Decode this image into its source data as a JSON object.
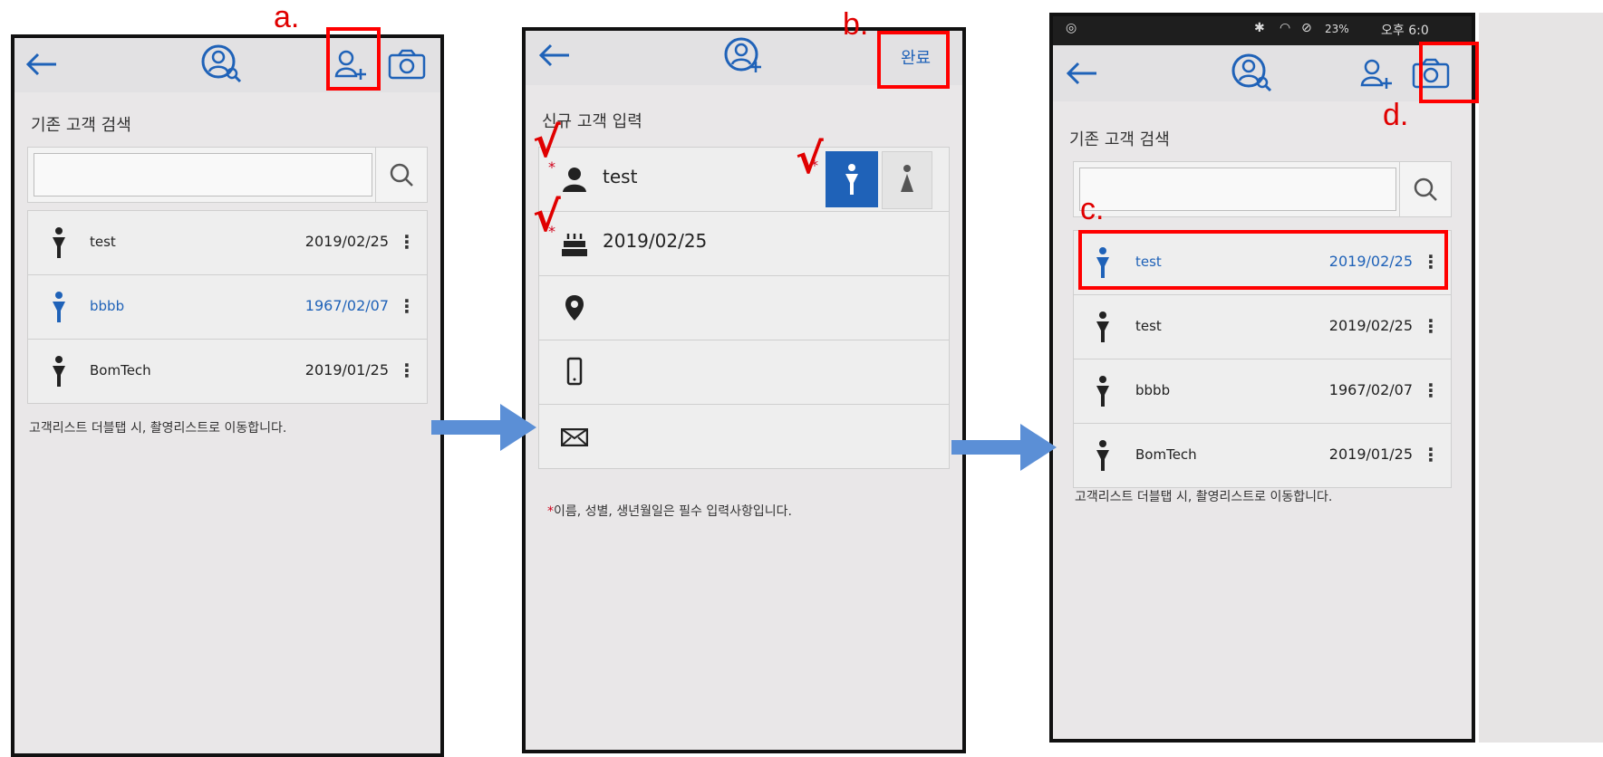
{
  "annotations": {
    "a": "a.",
    "b": "b.",
    "c": "c.",
    "d": "d.",
    "check": "√"
  },
  "screen1": {
    "section_title": "기존 고객 검색",
    "search_placeholder": "",
    "customers": [
      {
        "name": "test",
        "date": "2019/02/25",
        "selected": false
      },
      {
        "name": "bbbb",
        "date": "1967/02/07",
        "selected": true
      },
      {
        "name": "BomTech",
        "date": "2019/01/25",
        "selected": false
      }
    ],
    "hint": "고객리스트 더블탭 시, 촬영리스트로 이동합니다."
  },
  "screen2": {
    "done_label": "완료",
    "section_title": "신규 고객 입력",
    "name_value": "test",
    "birth_value": "2019/02/25",
    "required_star": "*",
    "required_note": "이름, 성별, 생년월일은 필수 입력사항입니다."
  },
  "screen3": {
    "status_bar": {
      "battery": "23%",
      "time": "오후 6:0"
    },
    "section_title": "기존 고객 검색",
    "customers": [
      {
        "name": "test",
        "date": "2019/02/25",
        "selected": true
      },
      {
        "name": "test",
        "date": "2019/02/25",
        "selected": false
      },
      {
        "name": "bbbb",
        "date": "1967/02/07",
        "selected": false
      },
      {
        "name": "BomTech",
        "date": "2019/01/25",
        "selected": false
      }
    ],
    "hint": "고객리스트 더블탭 시, 촬영리스트로 이동합니다."
  },
  "colors": {
    "accent": "#1f62b8",
    "annotation": "#ff0000",
    "arrow": "#5b8fd6"
  },
  "icons": [
    "back-arrow-icon",
    "customer-search-icon",
    "add-customer-icon",
    "camera-icon",
    "search-icon",
    "person-icon",
    "cake-icon",
    "location-pin-icon",
    "mobile-phone-icon",
    "mail-icon",
    "male-icon",
    "female-icon",
    "more-vert-icon"
  ]
}
